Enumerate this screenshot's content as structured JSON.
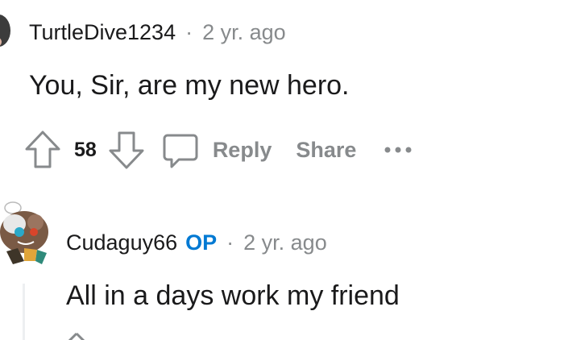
{
  "comments": [
    {
      "username": "TurtleDive1234",
      "separator": "·",
      "time": "2 yr. ago",
      "body": "You, Sir, are my new hero.",
      "score": "58",
      "actions": {
        "reply": "Reply",
        "share": "Share",
        "more": "•••"
      }
    },
    {
      "username": "Cudaguy66",
      "badge": "OP",
      "separator": "·",
      "time": "2 yr. ago",
      "body": "All in a days work my friend"
    }
  ],
  "colors": {
    "text": "#1a1a1b",
    "muted": "#878a8c",
    "op_badge": "#0079d3",
    "thread_line": "#edeff1"
  },
  "icons": {
    "upvote": "upvote-arrow-icon",
    "downvote": "downvote-arrow-icon",
    "comment": "comment-bubble-icon",
    "more": "more-options-icon"
  }
}
